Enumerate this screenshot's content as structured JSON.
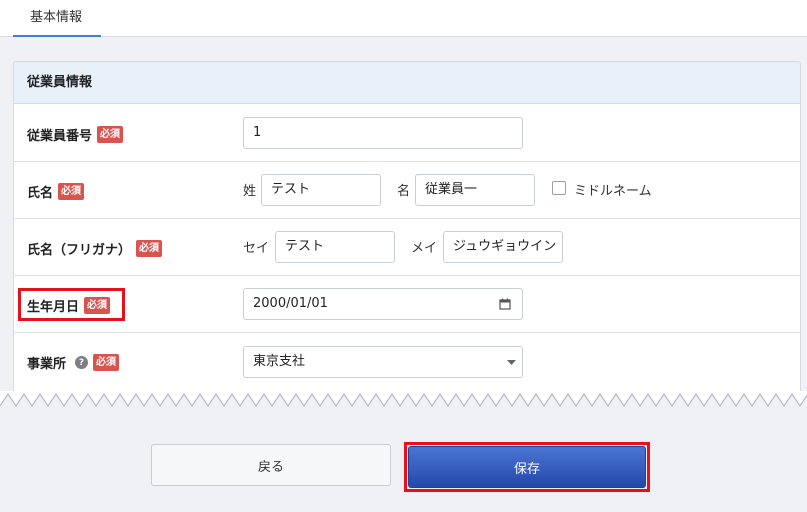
{
  "tabs": [
    {
      "label": "基本情報"
    }
  ],
  "section": {
    "title": "従業員情報"
  },
  "required_badge": "必須",
  "fields": {
    "employee_number": {
      "label": "従業員番号",
      "value": "1"
    },
    "name": {
      "label": "氏名",
      "last_label": "姓",
      "last_value": "テスト",
      "first_label": "名",
      "first_value": "従業員一",
      "middle_name_label": "ミドルネーム",
      "middle_name_checked": false
    },
    "name_kana": {
      "label": "氏名（フリガナ）",
      "last_label": "セイ",
      "last_value": "テスト",
      "first_label": "メイ",
      "first_value": "ジュウギョウイン"
    },
    "birthdate": {
      "label": "生年月日",
      "value": "2000/01/01"
    },
    "office": {
      "label": "事業所",
      "help_icon": "question-circle-icon",
      "value": "東京支社"
    }
  },
  "buttons": {
    "back": "戻る",
    "save": "保存"
  },
  "colors": {
    "required_badge": "#d9534f",
    "save_button": "#2f5bc4",
    "highlight": "#e8101b",
    "tab_underline": "#3d7fd0"
  }
}
